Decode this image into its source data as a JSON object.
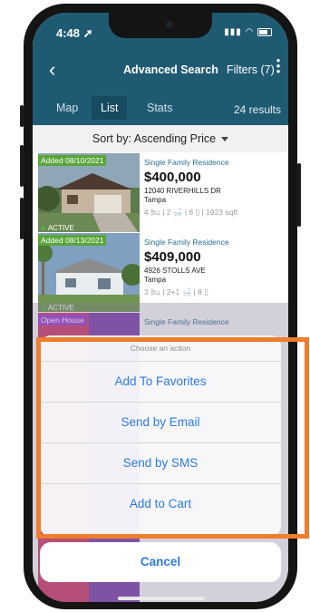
{
  "status_bar": {
    "time": "4:48"
  },
  "nav": {
    "back_icon": "chevron-left-icon",
    "title": "Advanced Search",
    "filters_label": "Filters (7)",
    "more_icon": "kebab-menu-icon"
  },
  "tabs": [
    {
      "label": "Map"
    },
    {
      "label": "List"
    },
    {
      "label": "Stats"
    }
  ],
  "results_label": "24 results",
  "sort": {
    "label": "Sort by: Ascending Price"
  },
  "listings": [
    {
      "tag": "Added 08/10/2021",
      "status": "ACTIVE",
      "type": "Single Family Residence",
      "price": "$400,000",
      "address": "12040 RIVERHILLS DR",
      "city": "Tampa",
      "features": "4 🛏 | 2 🛁 | 8 ▯ | 1923 sqft"
    },
    {
      "tag": "Added 08/13/2021",
      "status": "ACTIVE",
      "type": "Single Family Residence",
      "price": "$409,000",
      "address": "4926 STOLLS AVE",
      "city": "Tampa",
      "features": "3 🛏 | 2+1 🛁 | 8 ▯"
    },
    {
      "tag": "Open House",
      "type": "Single Family Residence"
    }
  ],
  "action_sheet": {
    "title": "Choose an action",
    "actions": [
      "Add To Favorites",
      "Send by Email",
      "Send by SMS",
      "Add to Cart"
    ],
    "cancel_label": "Cancel"
  },
  "colors": {
    "header": "#1f5a73",
    "action_text": "#2c7be5",
    "highlight_border": "#ef7d2b"
  }
}
